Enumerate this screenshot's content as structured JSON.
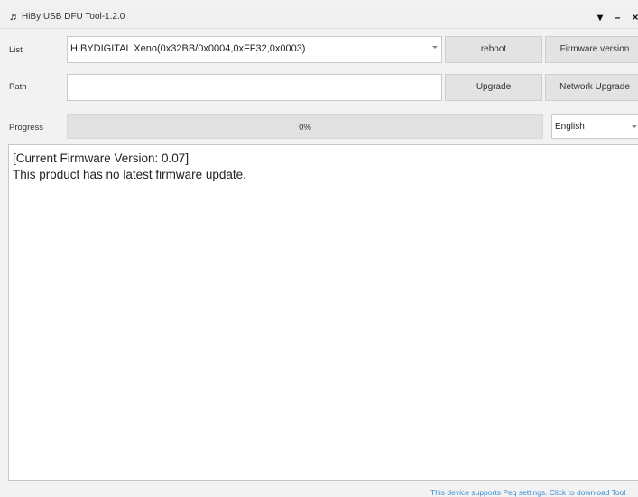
{
  "window": {
    "title": "HiBy USB DFU Tool-1.2.0",
    "controls": {
      "menu": "▾",
      "minimize": "–",
      "close": "×"
    }
  },
  "list_row": {
    "label": "List",
    "device_selected": "HIBYDIGITAL Xeno(0x32BB/0x0004,0xFF32,0x0003)",
    "reboot_label": "reboot",
    "firmware_version_label": "Firmware version"
  },
  "path_row": {
    "label": "Path",
    "path_value": "",
    "upgrade_label": "Upgrade",
    "network_upgrade_label": "Network Upgrade"
  },
  "progress_row": {
    "label": "Progress",
    "percent": 0,
    "percent_text": "0%",
    "language_selected": "English"
  },
  "log": {
    "lines": [
      "[Current Firmware Version: 0.07]",
      "This product has no latest firmware update."
    ]
  },
  "footer": {
    "link_text": "This device supports Peq settings. Click to download Tool"
  },
  "colors": {
    "link": "#3c8fd6",
    "button_bg": "#e3e3e3",
    "progress_track": "#e1e1e1"
  }
}
